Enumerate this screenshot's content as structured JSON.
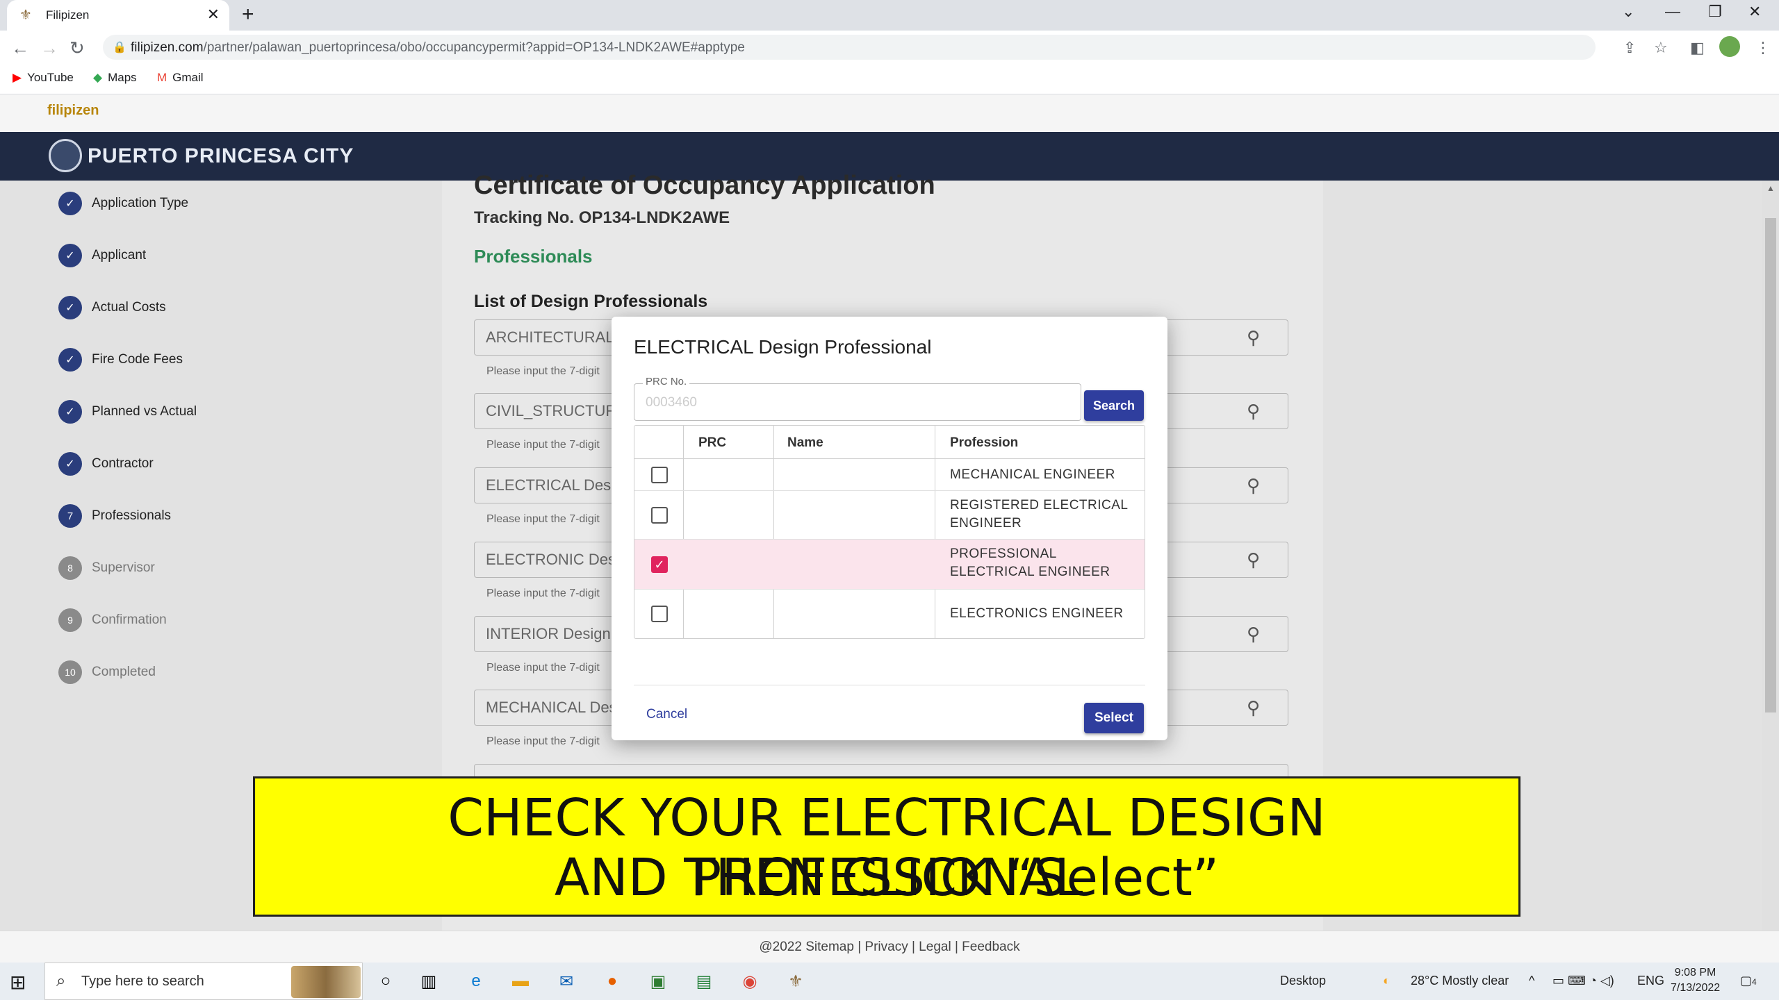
{
  "browser": {
    "tab_title": "Filipizen",
    "new_tab": "+",
    "url_host": "filipizen.com",
    "url_path": "/partner/palawan_puertoprincesa/obo/occupancypermit?appid=OP134-LNDK2AWE#apptype",
    "bookmarks": [
      {
        "label": "YouTube",
        "icon": "youtube-icon",
        "color": "#ff0000"
      },
      {
        "label": "Maps",
        "icon": "maps-icon",
        "color": "#34a853"
      },
      {
        "label": "Gmail",
        "icon": "gmail-icon",
        "color": "#ea4335"
      }
    ]
  },
  "site": {
    "logo_text": "filipizen",
    "city_name": "PUERTO PRINCESA CITY",
    "brand_color": "#1f2a44",
    "accent_color": "#2f3e9e"
  },
  "steps": [
    {
      "num": "",
      "label": "Application Type",
      "state": "done"
    },
    {
      "num": "",
      "label": "Applicant",
      "state": "done"
    },
    {
      "num": "",
      "label": "Actual Costs",
      "state": "done"
    },
    {
      "num": "",
      "label": "Fire Code Fees",
      "state": "done"
    },
    {
      "num": "",
      "label": "Planned vs Actual",
      "state": "done"
    },
    {
      "num": "",
      "label": "Contractor",
      "state": "done"
    },
    {
      "num": "7",
      "label": "Professionals",
      "state": "current"
    },
    {
      "num": "8",
      "label": "Supervisor",
      "state": "todo"
    },
    {
      "num": "9",
      "label": "Confirmation",
      "state": "todo"
    },
    {
      "num": "10",
      "label": "Completed",
      "state": "todo"
    }
  ],
  "form": {
    "title": "Certificate of Occupancy Application",
    "tracking": "Tracking No. OP134-LNDK2AWE",
    "section": "Professionals",
    "list_heading": "List of Design Professionals",
    "fields": [
      {
        "placeholder": "ARCHITECTURAL",
        "hint": "Please input the 7-digit"
      },
      {
        "placeholder": "CIVIL_STRUCTUR",
        "hint": "Please input the 7-digit"
      },
      {
        "placeholder": "ELECTRICAL Des",
        "hint": "Please input the 7-digit"
      },
      {
        "placeholder": "ELECTRONIC Des",
        "hint": "Please input the 7-digit"
      },
      {
        "placeholder": "INTERIOR Design",
        "hint": "Please input the 7-digit"
      },
      {
        "placeholder": "MECHANICAL Des",
        "hint": "Please input the 7-digit"
      }
    ]
  },
  "modal": {
    "title": "ELECTRICAL Design Professional",
    "prc_label": "PRC No.",
    "prc_value": "0003460",
    "search_label": "Search",
    "columns": [
      "PRC",
      "Name",
      "Profession"
    ],
    "rows": [
      {
        "prc": "",
        "name": "",
        "profession_lines": [
          "MECHANICAL ENGINEER"
        ],
        "selected": false
      },
      {
        "prc": "",
        "name": "",
        "profession_lines": [
          "REGISTERED ELECTRICAL",
          "ENGINEER"
        ],
        "selected": false
      },
      {
        "prc": "",
        "name": "",
        "profession_lines": [
          "PROFESSIONAL",
          "ELECTRICAL ENGINEER"
        ],
        "selected": true
      },
      {
        "prc": "",
        "name": "",
        "profession_lines": [
          "ELECTRONICS ENGINEER"
        ],
        "selected": false
      }
    ],
    "cancel_label": "Cancel",
    "select_label": "Select",
    "selected_color": "#e0245e"
  },
  "caption": {
    "line1": "CHECK YOUR ELECTRICAL DESIGN PROFESSIONAL",
    "line2": "AND THEN CLICK “Select”"
  },
  "footer": {
    "text": "@2022 Sitemap | Privacy | Legal | Feedback"
  },
  "taskbar": {
    "search_placeholder": "Type here to search",
    "desktop_label": "Desktop",
    "weather": "28°C  Mostly clear",
    "lang": "ENG",
    "time": "9:08 PM",
    "date": "7/13/2022",
    "notif_count": "4"
  }
}
